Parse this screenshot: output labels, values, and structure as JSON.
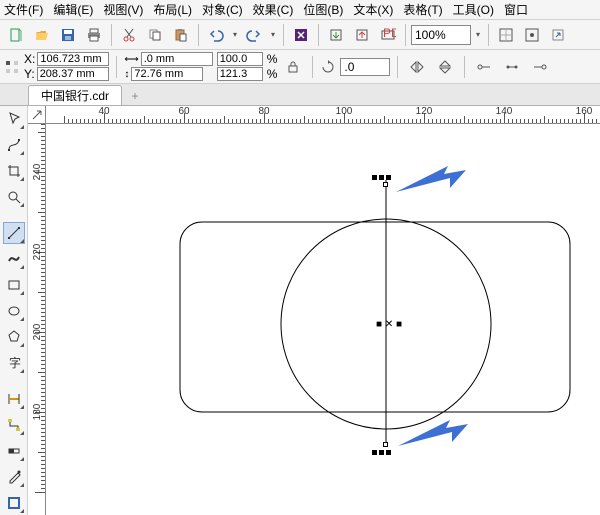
{
  "menu": {
    "file": "文件(F)",
    "edit": "编辑(E)",
    "view": "视图(V)",
    "layout": "布局(L)",
    "object": "对象(C)",
    "effects": "效果(C)",
    "bitmap": "位图(B)",
    "text": "文本(X)",
    "table": "表格(T)",
    "tools": "工具(O)",
    "window": "窗口"
  },
  "toolbar": {
    "zoom_value": "100%"
  },
  "props": {
    "x_label": "X:",
    "y_label": "Y:",
    "x_value": "106.723 mm",
    "y_value": "208.37 mm",
    "w_value": ".0 mm",
    "h_value": "72.76 mm",
    "scale_x": "100.0",
    "scale_y": "121.3",
    "pct": "%",
    "rot_value": ".0"
  },
  "tab": {
    "name": "中国银行.cdr",
    "plus": "+"
  },
  "ruler": {
    "h_labels": [
      "40",
      "60",
      "80",
      "100",
      "120",
      "140",
      "160"
    ],
    "v_labels": [
      "240",
      "220",
      "200",
      "180"
    ]
  },
  "icons": {
    "new": "new-icon",
    "open": "open-icon",
    "save": "save-icon",
    "print": "print-icon",
    "cut": "cut-icon",
    "copy": "copy-icon",
    "paste": "paste-icon",
    "undo": "undo-icon",
    "redo": "redo-icon",
    "import": "import-icon",
    "export": "export-icon",
    "publish": "publish-icon",
    "snap": "snap-icon",
    "options": "options-icon",
    "launch": "launch-icon",
    "coord": "coord-icon",
    "width": "width-icon",
    "height": "height-icon",
    "lock": "lock-icon",
    "rotate": "rotate-icon",
    "mirror-h": "mirror-h-icon",
    "mirror-v": "mirror-v-icon",
    "start": "line-start-icon",
    "segment": "line-segment-icon",
    "end": "line-end-icon",
    "pick": "pick-tool",
    "shape": "shape-tool",
    "crop": "crop-tool",
    "zoom": "zoom-tool",
    "freehand": "freehand-tool",
    "artistic": "artistic-tool",
    "rect": "rectangle-tool",
    "ellipse": "ellipse-tool",
    "polygon": "polygon-tool",
    "text": "text-tool",
    "dimension": "dimension-tool",
    "connector": "connector-tool",
    "interactive": "interactive-tool",
    "dropper": "eyedropper-tool",
    "outline": "outline-tool"
  }
}
